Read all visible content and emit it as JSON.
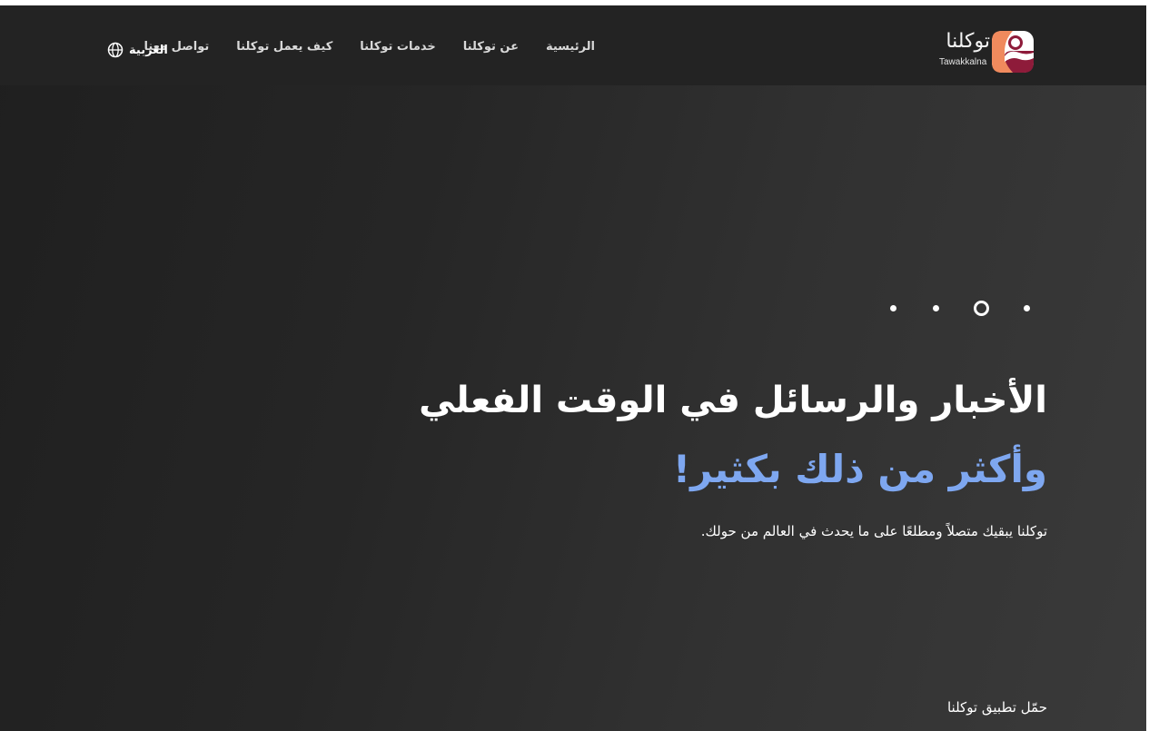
{
  "header": {
    "logo": {
      "name_ar": "توكلنا",
      "name_en": "Tawakkalna",
      "icon": "tawakkalna-logo-icon",
      "colors": [
        "#f08a5d",
        "#8e1b3a",
        "#ffffff"
      ]
    },
    "nav": {
      "items": [
        {
          "label": "الرئيسية"
        },
        {
          "label": "عن توكلنا"
        },
        {
          "label": "خدمات توكلنا"
        },
        {
          "label": "كيف يعمل توكلنا"
        },
        {
          "label": "تواصل معنا"
        }
      ]
    },
    "language": {
      "label": "العربية",
      "icon": "globe-icon"
    }
  },
  "hero": {
    "carousel": {
      "slide_count": 4,
      "active_index": 1
    },
    "title": "الأخبار والرسائل في الوقت الفعلي",
    "subtitle": "وأكثر من ذلك بكثير!",
    "description": "توكلنا يبقيك متصلاً ومطلعًا على ما يحدث في العالم من حولك.",
    "download_label": "حمّل تطبيق توكلنا",
    "colors": {
      "accent": "#7ea7f0",
      "background_dark": "#1f1f1f",
      "background_light": "#3a3a3a",
      "text": "#ffffff"
    }
  }
}
